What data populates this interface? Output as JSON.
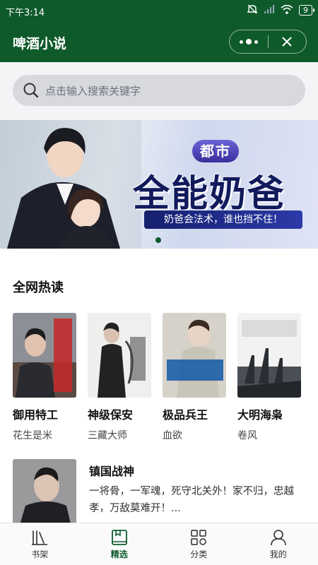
{
  "status_bar": {
    "time": "下午3:14",
    "battery": "9"
  },
  "header": {
    "title": "啤酒小说"
  },
  "search": {
    "placeholder": "点击输入搜索关键字"
  },
  "banner": {
    "tag": "都市",
    "title": "全能奶爸",
    "slogan": "奶爸会法术，谁也挡不住！"
  },
  "section": {
    "title": "全网热读"
  },
  "books": [
    {
      "title": "御用特工",
      "author": "花生是米"
    },
    {
      "title": "神级保安",
      "author": "三藏大师"
    },
    {
      "title": "极品兵王",
      "author": "血欲"
    },
    {
      "title": "大明海枭",
      "author": "卷风"
    }
  ],
  "featured": {
    "title": "镇国战神",
    "description": "一将骨，一军魂，死守北关外！家不归，忠越孝，万敌莫难开！..."
  },
  "tabs": [
    {
      "label": "书架",
      "active": false
    },
    {
      "label": "精选",
      "active": true
    },
    {
      "label": "分类",
      "active": false
    },
    {
      "label": "我的",
      "active": false
    }
  ],
  "colors": {
    "brand": "#0f5a2b",
    "background": "#ffffff"
  }
}
